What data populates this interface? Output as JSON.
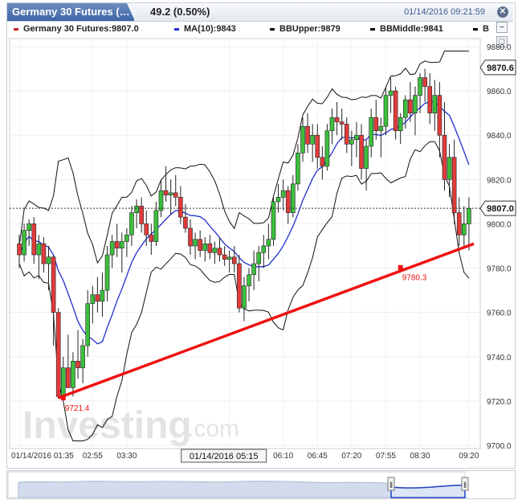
{
  "header": {
    "tab_title": "Germany 30 Futures (…",
    "change": "49.2 (0.50%)",
    "datetime": "01/14/2016 09:21:59",
    "close_glyph": "✕"
  },
  "legend": {
    "items": [
      {
        "label": "Germany 30 Futures:9807.0",
        "color": "#cc2222"
      },
      {
        "label": "MA(10):9843",
        "color": "#1f2fd8"
      },
      {
        "label": "BBUpper:9879",
        "color": "#000000"
      },
      {
        "label": "BBMiddle:9841",
        "color": "#000000"
      },
      {
        "label": "B",
        "color": "#000000"
      }
    ],
    "side_buttons": [
      "−",
      "□"
    ]
  },
  "chart_data": {
    "type": "candlestick",
    "title": "Germany 30 Futures",
    "y_ticks": [
      "9880.0",
      "9860.0",
      "9840.0",
      "9820.0",
      "9800.0",
      "9780.0",
      "9760.0",
      "9740.0",
      "9720.0",
      "9700.0"
    ],
    "ylim": [
      9700,
      9880
    ],
    "x_ticks": [
      {
        "label": "01/14/2016 01:35",
        "index": 0
      },
      {
        "label": "02:55",
        "index": 15
      },
      {
        "label": "03:30",
        "index": 22
      },
      {
        "label": "05:15",
        "index": 43
      },
      {
        "label": "06:10",
        "index": 54
      },
      {
        "label": "06:45",
        "index": 61
      },
      {
        "label": "07:20",
        "index": 68
      },
      {
        "label": "07:55",
        "index": 75
      },
      {
        "label": "08:30",
        "index": 82
      },
      {
        "label": "09:20",
        "index": 92
      }
    ],
    "crosshair_label": "01/14/2016 05:15",
    "last_price": {
      "value": 9807.0,
      "label": "9807.0"
    },
    "upper_marker": {
      "value": 9870.6,
      "label": "9870.6"
    },
    "trendline": {
      "from": {
        "index": 8,
        "value": 9721.4
      },
      "to": {
        "index": 93,
        "value": 9791.0
      },
      "color": "#ee1111"
    },
    "trendline_labels": [
      {
        "index": 9,
        "value": 9721.4,
        "label": "9721.4"
      },
      {
        "index": 78,
        "value": 9780.3,
        "label": "9780.3"
      }
    ],
    "candles": [
      [
        9791,
        9795,
        9780,
        9786
      ],
      [
        9786,
        9800,
        9783,
        9797
      ],
      [
        9797,
        9802,
        9790,
        9800
      ],
      [
        9800,
        9803,
        9782,
        9786
      ],
      [
        9786,
        9795,
        9775,
        9791
      ],
      [
        9791,
        9794,
        9778,
        9782
      ],
      [
        9782,
        9790,
        9770,
        9785
      ],
      [
        9785,
        9786,
        9745,
        9760
      ],
      [
        9760,
        9762,
        9721,
        9722
      ],
      [
        9722,
        9740,
        9721,
        9735
      ],
      [
        9735,
        9750,
        9730,
        9726
      ],
      [
        9726,
        9742,
        9722,
        9738
      ],
      [
        9738,
        9752,
        9730,
        9735
      ],
      [
        9735,
        9748,
        9728,
        9745
      ],
      [
        9745,
        9770,
        9740,
        9764
      ],
      [
        9764,
        9772,
        9755,
        9768
      ],
      [
        9768,
        9776,
        9760,
        9765
      ],
      [
        9765,
        9778,
        9758,
        9770
      ],
      [
        9770,
        9790,
        9765,
        9786
      ],
      [
        9786,
        9795,
        9780,
        9792
      ],
      [
        9792,
        9800,
        9785,
        9789
      ],
      [
        9789,
        9796,
        9778,
        9792
      ],
      [
        9792,
        9798,
        9785,
        9795
      ],
      [
        9795,
        9808,
        9790,
        9805
      ],
      [
        9805,
        9811,
        9798,
        9808
      ],
      [
        9808,
        9812,
        9796,
        9800
      ],
      [
        9800,
        9806,
        9790,
        9795
      ],
      [
        9795,
        9800,
        9786,
        9792
      ],
      [
        9792,
        9810,
        9790,
        9806
      ],
      [
        9806,
        9820,
        9803,
        9815
      ],
      [
        9815,
        9826,
        9810,
        9813
      ],
      [
        9813,
        9820,
        9804,
        9814
      ],
      [
        9814,
        9822,
        9808,
        9812
      ],
      [
        9812,
        9817,
        9800,
        9803
      ],
      [
        9803,
        9809,
        9796,
        9798
      ],
      [
        9798,
        9802,
        9786,
        9790
      ],
      [
        9790,
        9796,
        9784,
        9793
      ],
      [
        9793,
        9797,
        9785,
        9788
      ],
      [
        9788,
        9794,
        9783,
        9791
      ],
      [
        9791,
        9795,
        9784,
        9787
      ],
      [
        9787,
        9792,
        9782,
        9789
      ],
      [
        9789,
        9794,
        9783,
        9786
      ],
      [
        9786,
        9790,
        9781,
        9784
      ],
      [
        9784,
        9788,
        9778,
        9785
      ],
      [
        9785,
        9790,
        9778,
        9782
      ],
      [
        9782,
        9786,
        9760,
        9762
      ],
      [
        9762,
        9776,
        9756,
        9772
      ],
      [
        9772,
        9780,
        9765,
        9777
      ],
      [
        9777,
        9788,
        9770,
        9782
      ],
      [
        9782,
        9790,
        9774,
        9787
      ],
      [
        9787,
        9795,
        9780,
        9790
      ],
      [
        9790,
        9800,
        9784,
        9793
      ],
      [
        9793,
        9812,
        9790,
        9810
      ],
      [
        9810,
        9818,
        9805,
        9812
      ],
      [
        9812,
        9820,
        9806,
        9815
      ],
      [
        9815,
        9817,
        9800,
        9805
      ],
      [
        9805,
        9822,
        9803,
        9818
      ],
      [
        9818,
        9836,
        9815,
        9832
      ],
      [
        9832,
        9848,
        9828,
        9844
      ],
      [
        9844,
        9850,
        9832,
        9836
      ],
      [
        9836,
        9845,
        9828,
        9840
      ],
      [
        9840,
        9845,
        9825,
        9830
      ],
      [
        9830,
        9835,
        9820,
        9826
      ],
      [
        9826,
        9845,
        9824,
        9842
      ],
      [
        9842,
        9852,
        9836,
        9848
      ],
      [
        9848,
        9855,
        9840,
        9846
      ],
      [
        9846,
        9852,
        9838,
        9845
      ],
      [
        9845,
        9848,
        9832,
        9836
      ],
      [
        9836,
        9842,
        9826,
        9838
      ],
      [
        9838,
        9846,
        9830,
        9840
      ],
      [
        9840,
        9845,
        9820,
        9825
      ],
      [
        9825,
        9838,
        9815,
        9835
      ],
      [
        9835,
        9852,
        9830,
        9848
      ],
      [
        9848,
        9856,
        9838,
        9842
      ],
      [
        9842,
        9848,
        9830,
        9844
      ],
      [
        9844,
        9862,
        9840,
        9858
      ],
      [
        9858,
        9866,
        9850,
        9860
      ],
      [
        9860,
        9862,
        9838,
        9842
      ],
      [
        9842,
        9850,
        9836,
        9848
      ],
      [
        9848,
        9858,
        9843,
        9856
      ],
      [
        9856,
        9864,
        9846,
        9850
      ],
      [
        9850,
        9862,
        9840,
        9858
      ],
      [
        9858,
        9868,
        9850,
        9866
      ],
      [
        9866,
        9870,
        9855,
        9862
      ],
      [
        9862,
        9868,
        9845,
        9850
      ],
      [
        9850,
        9865,
        9842,
        9858
      ],
      [
        9858,
        9864,
        9830,
        9840
      ],
      [
        9840,
        9855,
        9815,
        9820
      ],
      [
        9820,
        9836,
        9812,
        9830
      ],
      [
        9830,
        9838,
        9800,
        9805
      ],
      [
        9805,
        9812,
        9790,
        9795
      ],
      [
        9795,
        9808,
        9790,
        9800
      ],
      [
        9800,
        9812,
        9788,
        9807
      ]
    ]
  },
  "watermark": {
    "brand": "Investing",
    "suffix": ".com"
  },
  "navigator": {
    "handle_glyph": "‖"
  }
}
